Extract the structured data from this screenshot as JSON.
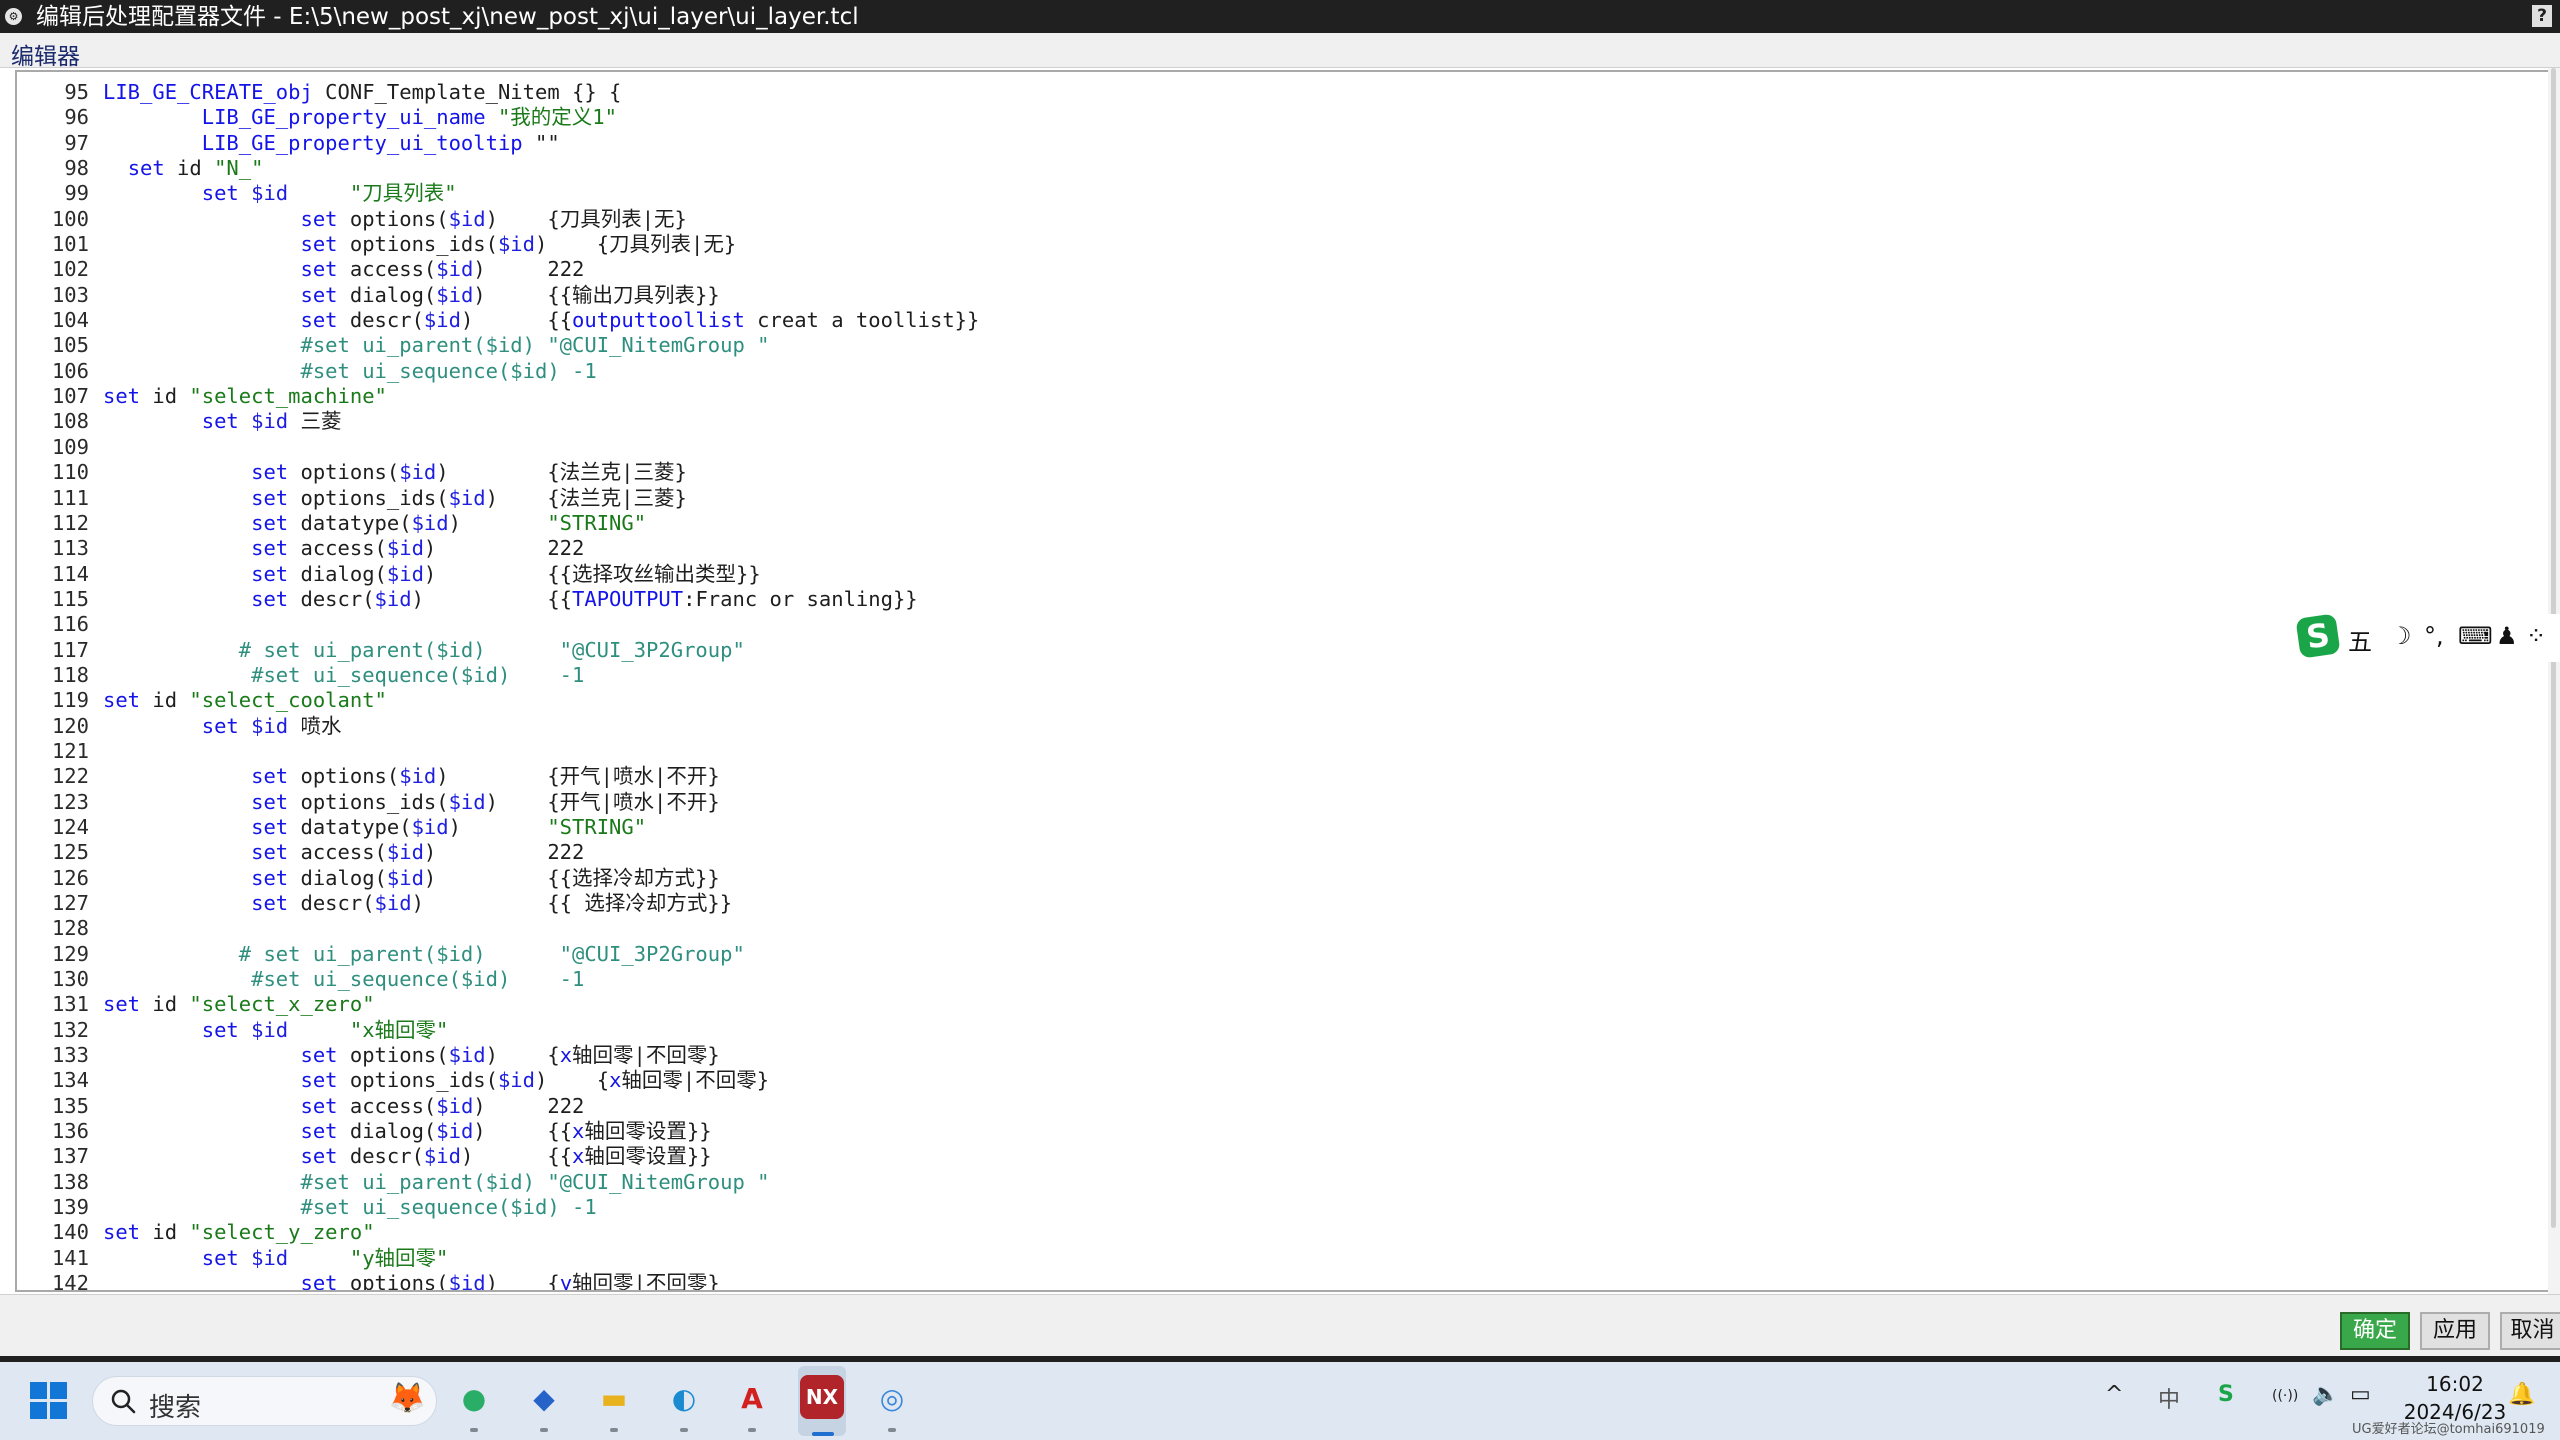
{
  "window": {
    "title": "编辑后处理配置器文件 - E:\\5\\new_post_xj\\new_post_xj\\ui_layer\\ui_layer.tcl",
    "help_label": "?"
  },
  "menu": {
    "editor_label": "编辑器"
  },
  "code_lines": [
    {
      "n": "95",
      "t": [
        [
          "LIB_GE_CREATE_obj",
          "kw"
        ],
        [
          " CONF_Template_Nitem {} {",
          "pl"
        ]
      ]
    },
    {
      "n": "96",
      "t": [
        [
          "        ",
          "pl"
        ],
        [
          "LIB_GE_property_ui_name",
          "kw"
        ],
        [
          " ",
          "pl"
        ],
        [
          "\"我的定义1\"",
          "st"
        ]
      ]
    },
    {
      "n": "97",
      "t": [
        [
          "        ",
          "pl"
        ],
        [
          "LIB_GE_property_ui_tooltip",
          "kw"
        ],
        [
          " \"\"",
          "pl"
        ]
      ]
    },
    {
      "n": "98",
      "t": [
        [
          "  ",
          "pl"
        ],
        [
          "set",
          "kw"
        ],
        [
          " id ",
          "pl"
        ],
        [
          "\"N_\"",
          "st"
        ]
      ]
    },
    {
      "n": "99",
      "t": [
        [
          "        ",
          "pl"
        ],
        [
          "set",
          "kw"
        ],
        [
          " ",
          "pl"
        ],
        [
          "$id",
          "vr"
        ],
        [
          "     ",
          "pl"
        ],
        [
          "\"刀具列表\"",
          "st"
        ]
      ]
    },
    {
      "n": "100",
      "t": [
        [
          "                ",
          "pl"
        ],
        [
          "set",
          "kw"
        ],
        [
          " options(",
          "pl"
        ],
        [
          "$id",
          "vr"
        ],
        [
          ")    {刀具列表|无}",
          "pl"
        ]
      ]
    },
    {
      "n": "101",
      "t": [
        [
          "                ",
          "pl"
        ],
        [
          "set",
          "kw"
        ],
        [
          " options_ids(",
          "pl"
        ],
        [
          "$id",
          "vr"
        ],
        [
          ")    {刀具列表|无}",
          "pl"
        ]
      ]
    },
    {
      "n": "102",
      "t": [
        [
          "                ",
          "pl"
        ],
        [
          "set",
          "kw"
        ],
        [
          " access(",
          "pl"
        ],
        [
          "$id",
          "vr"
        ],
        [
          ")     222",
          "pl"
        ]
      ]
    },
    {
      "n": "103",
      "t": [
        [
          "                ",
          "pl"
        ],
        [
          "set",
          "kw"
        ],
        [
          " dialog(",
          "pl"
        ],
        [
          "$id",
          "vr"
        ],
        [
          ")     {{输出刀具列表}}",
          "pl"
        ]
      ]
    },
    {
      "n": "104",
      "t": [
        [
          "                ",
          "pl"
        ],
        [
          "set",
          "kw"
        ],
        [
          " descr(",
          "pl"
        ],
        [
          "$id",
          "vr"
        ],
        [
          ")      {{",
          "pl"
        ],
        [
          "outputtoollist",
          "kw"
        ],
        [
          " creat a toollist}}",
          "pl"
        ]
      ]
    },
    {
      "n": "105",
      "t": [
        [
          "                ",
          "pl"
        ],
        [
          "#set ui_parent($id) \"@CUI_NitemGroup \"",
          "cm"
        ]
      ]
    },
    {
      "n": "106",
      "t": [
        [
          "                ",
          "pl"
        ],
        [
          "#set ui_sequence($id) -1",
          "cm"
        ]
      ]
    },
    {
      "n": "107",
      "t": [
        [
          "set",
          "kw"
        ],
        [
          " id ",
          "pl"
        ],
        [
          "\"select_machine\"",
          "st"
        ]
      ]
    },
    {
      "n": "108",
      "t": [
        [
          "        ",
          "pl"
        ],
        [
          "set",
          "kw"
        ],
        [
          " ",
          "pl"
        ],
        [
          "$id",
          "vr"
        ],
        [
          " 三菱",
          "pl"
        ]
      ]
    },
    {
      "n": "109",
      "t": [
        [
          "",
          "pl"
        ]
      ]
    },
    {
      "n": "110",
      "t": [
        [
          "            ",
          "pl"
        ],
        [
          "set",
          "kw"
        ],
        [
          " options(",
          "pl"
        ],
        [
          "$id",
          "vr"
        ],
        [
          ")        {法兰克|三菱}",
          "pl"
        ]
      ]
    },
    {
      "n": "111",
      "t": [
        [
          "            ",
          "pl"
        ],
        [
          "set",
          "kw"
        ],
        [
          " options_ids(",
          "pl"
        ],
        [
          "$id",
          "vr"
        ],
        [
          ")    {法兰克|三菱}",
          "pl"
        ]
      ]
    },
    {
      "n": "112",
      "t": [
        [
          "            ",
          "pl"
        ],
        [
          "set",
          "kw"
        ],
        [
          " datatype(",
          "pl"
        ],
        [
          "$id",
          "vr"
        ],
        [
          ")       ",
          "pl"
        ],
        [
          "\"STRING\"",
          "st"
        ]
      ]
    },
    {
      "n": "113",
      "t": [
        [
          "            ",
          "pl"
        ],
        [
          "set",
          "kw"
        ],
        [
          " access(",
          "pl"
        ],
        [
          "$id",
          "vr"
        ],
        [
          ")         222",
          "pl"
        ]
      ]
    },
    {
      "n": "114",
      "t": [
        [
          "            ",
          "pl"
        ],
        [
          "set",
          "kw"
        ],
        [
          " dialog(",
          "pl"
        ],
        [
          "$id",
          "vr"
        ],
        [
          ")         {{选择攻丝输出类型}}",
          "pl"
        ]
      ]
    },
    {
      "n": "115",
      "t": [
        [
          "            ",
          "pl"
        ],
        [
          "set",
          "kw"
        ],
        [
          " descr(",
          "pl"
        ],
        [
          "$id",
          "vr"
        ],
        [
          ")          {{",
          "pl"
        ],
        [
          "TAPOUTPUT",
          "kw"
        ],
        [
          ":Franc or sanling}}",
          "pl"
        ]
      ]
    },
    {
      "n": "116",
      "t": [
        [
          "",
          "pl"
        ]
      ]
    },
    {
      "n": "117",
      "t": [
        [
          "           ",
          "pl"
        ],
        [
          "# set ui_parent($id)      \"@CUI_3P2Group\"",
          "cm"
        ]
      ]
    },
    {
      "n": "118",
      "t": [
        [
          "            ",
          "pl"
        ],
        [
          "#set ui_sequence($id)    -1",
          "cm"
        ]
      ]
    },
    {
      "n": "119",
      "t": [
        [
          "set",
          "kw"
        ],
        [
          " id ",
          "pl"
        ],
        [
          "\"select_coolant\"",
          "st"
        ]
      ]
    },
    {
      "n": "120",
      "t": [
        [
          "        ",
          "pl"
        ],
        [
          "set",
          "kw"
        ],
        [
          " ",
          "pl"
        ],
        [
          "$id",
          "vr"
        ],
        [
          " 喷水",
          "pl"
        ]
      ]
    },
    {
      "n": "121",
      "t": [
        [
          "",
          "pl"
        ]
      ]
    },
    {
      "n": "122",
      "t": [
        [
          "            ",
          "pl"
        ],
        [
          "set",
          "kw"
        ],
        [
          " options(",
          "pl"
        ],
        [
          "$id",
          "vr"
        ],
        [
          ")        {开气|喷水|不开}",
          "pl"
        ]
      ]
    },
    {
      "n": "123",
      "t": [
        [
          "            ",
          "pl"
        ],
        [
          "set",
          "kw"
        ],
        [
          " options_ids(",
          "pl"
        ],
        [
          "$id",
          "vr"
        ],
        [
          ")    {开气|喷水|不开}",
          "pl"
        ]
      ]
    },
    {
      "n": "124",
      "t": [
        [
          "            ",
          "pl"
        ],
        [
          "set",
          "kw"
        ],
        [
          " datatype(",
          "pl"
        ],
        [
          "$id",
          "vr"
        ],
        [
          ")       ",
          "pl"
        ],
        [
          "\"STRING\"",
          "st"
        ]
      ]
    },
    {
      "n": "125",
      "t": [
        [
          "            ",
          "pl"
        ],
        [
          "set",
          "kw"
        ],
        [
          " access(",
          "pl"
        ],
        [
          "$id",
          "vr"
        ],
        [
          ")         222",
          "pl"
        ]
      ]
    },
    {
      "n": "126",
      "t": [
        [
          "            ",
          "pl"
        ],
        [
          "set",
          "kw"
        ],
        [
          " dialog(",
          "pl"
        ],
        [
          "$id",
          "vr"
        ],
        [
          ")         {{选择冷却方式}}",
          "pl"
        ]
      ]
    },
    {
      "n": "127",
      "t": [
        [
          "            ",
          "pl"
        ],
        [
          "set",
          "kw"
        ],
        [
          " descr(",
          "pl"
        ],
        [
          "$id",
          "vr"
        ],
        [
          ")          {{ 选择冷却方式}}",
          "pl"
        ]
      ]
    },
    {
      "n": "128",
      "t": [
        [
          "",
          "pl"
        ]
      ]
    },
    {
      "n": "129",
      "t": [
        [
          "           ",
          "pl"
        ],
        [
          "# set ui_parent($id)      \"@CUI_3P2Group\"",
          "cm"
        ]
      ]
    },
    {
      "n": "130",
      "t": [
        [
          "            ",
          "pl"
        ],
        [
          "#set ui_sequence($id)    -1",
          "cm"
        ]
      ]
    },
    {
      "n": "131",
      "t": [
        [
          "set",
          "kw"
        ],
        [
          " id ",
          "pl"
        ],
        [
          "\"select_x_zero\"",
          "st"
        ]
      ]
    },
    {
      "n": "132",
      "t": [
        [
          "        ",
          "pl"
        ],
        [
          "set",
          "kw"
        ],
        [
          " ",
          "pl"
        ],
        [
          "$id",
          "vr"
        ],
        [
          "     ",
          "pl"
        ],
        [
          "\"x轴回零\"",
          "st"
        ]
      ]
    },
    {
      "n": "133",
      "t": [
        [
          "                ",
          "pl"
        ],
        [
          "set",
          "kw"
        ],
        [
          " options(",
          "pl"
        ],
        [
          "$id",
          "vr"
        ],
        [
          ")    {",
          "pl"
        ],
        [
          "x",
          "kw"
        ],
        [
          "轴回零|不回零}",
          "pl"
        ]
      ]
    },
    {
      "n": "134",
      "t": [
        [
          "                ",
          "pl"
        ],
        [
          "set",
          "kw"
        ],
        [
          " options_ids(",
          "pl"
        ],
        [
          "$id",
          "vr"
        ],
        [
          ")    {",
          "pl"
        ],
        [
          "x",
          "kw"
        ],
        [
          "轴回零|不回零}",
          "pl"
        ]
      ]
    },
    {
      "n": "135",
      "t": [
        [
          "                ",
          "pl"
        ],
        [
          "set",
          "kw"
        ],
        [
          " access(",
          "pl"
        ],
        [
          "$id",
          "vr"
        ],
        [
          ")     222",
          "pl"
        ]
      ]
    },
    {
      "n": "136",
      "t": [
        [
          "                ",
          "pl"
        ],
        [
          "set",
          "kw"
        ],
        [
          " dialog(",
          "pl"
        ],
        [
          "$id",
          "vr"
        ],
        [
          ")     {{",
          "pl"
        ],
        [
          "x",
          "kw"
        ],
        [
          "轴回零设置}}",
          "pl"
        ]
      ]
    },
    {
      "n": "137",
      "t": [
        [
          "                ",
          "pl"
        ],
        [
          "set",
          "kw"
        ],
        [
          " descr(",
          "pl"
        ],
        [
          "$id",
          "vr"
        ],
        [
          ")      {{",
          "pl"
        ],
        [
          "x",
          "kw"
        ],
        [
          "轴回零设置}}",
          "pl"
        ]
      ]
    },
    {
      "n": "138",
      "t": [
        [
          "                ",
          "pl"
        ],
        [
          "#set ui_parent($id) \"@CUI_NitemGroup \"",
          "cm"
        ]
      ]
    },
    {
      "n": "139",
      "t": [
        [
          "                ",
          "pl"
        ],
        [
          "#set ui_sequence($id) -1",
          "cm"
        ]
      ]
    },
    {
      "n": "140",
      "t": [
        [
          "set",
          "kw"
        ],
        [
          " id ",
          "pl"
        ],
        [
          "\"select_y_zero\"",
          "st"
        ]
      ]
    },
    {
      "n": "141",
      "t": [
        [
          "        ",
          "pl"
        ],
        [
          "set",
          "kw"
        ],
        [
          " ",
          "pl"
        ],
        [
          "$id",
          "vr"
        ],
        [
          "     ",
          "pl"
        ],
        [
          "\"y轴回零\"",
          "st"
        ]
      ]
    },
    {
      "n": "142",
      "t": [
        [
          "                ",
          "pl"
        ],
        [
          "set",
          "kw"
        ],
        [
          " options(",
          "pl"
        ],
        [
          "$id",
          "vr"
        ],
        [
          ")    {",
          "pl"
        ],
        [
          "y",
          "kw"
        ],
        [
          "轴回零|不回零}",
          "pl"
        ]
      ]
    }
  ],
  "ime_toolbar": {
    "logo": "S",
    "mode": "五",
    "items": [
      "☽",
      "°,",
      "⌨",
      "♟",
      "⁘"
    ]
  },
  "buttons": {
    "ok": "确定",
    "apply": "应用",
    "cancel": "取消"
  },
  "taskbar": {
    "search_placeholder": "搜索",
    "search_deco": "🦊",
    "apps": [
      {
        "name": "wechat-app",
        "glyph": "●",
        "color": "#2aae67"
      },
      {
        "name": "shell-app",
        "glyph": "◆",
        "color": "#2563c9"
      },
      {
        "name": "file-explorer-app",
        "glyph": "▬",
        "color": "#e8b21e"
      },
      {
        "name": "edge-browser-app",
        "glyph": "◐",
        "color": "#1a8ad1"
      },
      {
        "name": "acrobat-app",
        "glyph": "A",
        "color": "#d22020"
      },
      {
        "name": "nx-app",
        "glyph": "NX",
        "color": "#ffffff"
      },
      {
        "name": "globe-app",
        "glyph": "◎",
        "color": "#3a86d9"
      }
    ],
    "tray": {
      "chevron": "^",
      "lang": "中",
      "ime": "S",
      "wifi": "((·))",
      "volume": "🔈",
      "battery": "▭"
    },
    "time": "16:02",
    "date": "2024/6/23",
    "bell": "🔔"
  },
  "watermark": "UG爱好者论坛@tomhai691019",
  "colors": {
    "ok_button": "#39a84a",
    "keyword": "#1414e8",
    "string": "#1a7a1a",
    "comment": "#2f8f7f"
  }
}
